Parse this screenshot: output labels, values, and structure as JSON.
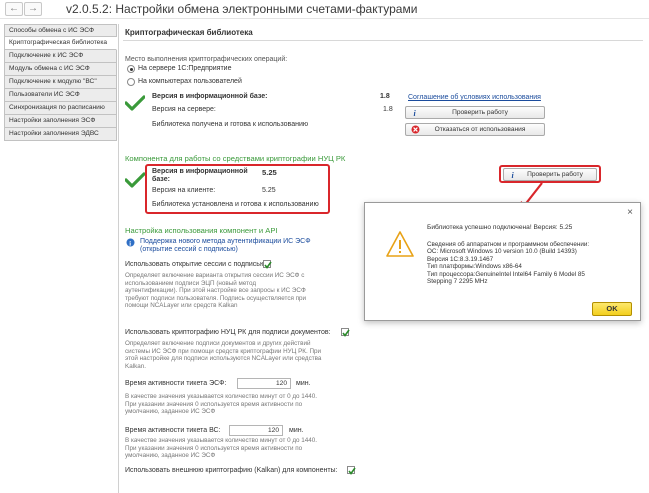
{
  "window": {
    "title": "v2.0.5.2: Настройки обмена электронными счетами-фактурами",
    "back_glyph": "←",
    "forward_glyph": "→"
  },
  "sidebar": {
    "items": [
      {
        "label": "Способы обмена с ИС ЭСФ"
      },
      {
        "label": "Криптографическая библиотека"
      },
      {
        "label": "Подключение к ИС ЭСФ"
      },
      {
        "label": "Модуль обмена с ИС ЭСФ"
      },
      {
        "label": "Подключение к модулю \"ВС\""
      },
      {
        "label": "Пользователи ИС ЭСФ"
      },
      {
        "label": "Синхронизация по расписанию"
      },
      {
        "label": "Настройки заполнения ЭСФ"
      },
      {
        "label": "Настройки заполнения ЭДВС"
      }
    ]
  },
  "crypto": {
    "title": "Криптографическая библиотека",
    "location_label": "Место выполнения криптографических операций:",
    "radio_server": "На сервере 1С:Предприятие",
    "radio_client": "На компьютерах пользователей",
    "version_db_label": "Версия в информационной базе:",
    "version_db": "1.8",
    "version_server_label": "Версия на сервере:",
    "version_server": "1.8",
    "status": "Библиотека получена и готова к использованию",
    "agreement_link": "Соглашение об условиях использования",
    "check_button": "Проверить работу",
    "refuse_button": "Отказаться от использования"
  },
  "ncu": {
    "title": "Компонента для работы со средствами криптографии НУЦ РК",
    "version_db_label_1": "Версия в информационной",
    "version_db_label_2": "базе:",
    "version_db": "5.25",
    "version_client_label": "Версия на клиенте:",
    "version_client": "5.25",
    "status": "Библиотека установлена и готова к использованию",
    "check_button": "Проверить работу"
  },
  "api": {
    "title": "Настройка использования компонент и API",
    "support_line1": "Поддержка нового метода аутентификации ИС ЭСФ",
    "support_line2": "(открытие сессий с подписью)",
    "open_session_label": "Использовать открытие сессии с подписью:",
    "open_session_desc": "Определяет включение варианта открытия сессии ИС ЭСФ с использованием подписи ЭЦП (новый метод аутентификации). При этой настройке все запросы к ИС ЭСФ требуют подписи пользователя. Подпись осуществляется при помощи NCALayer или средств Kalkan",
    "ncu_sign_label": "Использовать криптографию НУЦ РК для подписи документов:",
    "ncu_sign_desc": "Определяет включение подписи документов и других действий системы ИС ЭСФ при помощи средств криптографии НУЦ РК. При этой настройке для подписи используются NCALayer или средства Kalkan.",
    "esf_ticket_label": "Время активности тикета ЭСФ:",
    "esf_ticket_value": "120",
    "esf_ticket_unit": "мин.",
    "esf_ticket_desc": "В качестве значения указывается количество минут от 0 до 1440. При указании значения 0 используется время активности по умолчанию, заданное ИС ЭСФ",
    "vs_ticket_label": "Время активности тикета ВС:",
    "vs_ticket_value": "120",
    "vs_ticket_unit": "мин.",
    "vs_ticket_desc": "В качестве значения указывается количество минут от 0 до 1440. При указании значения 0 используется время активности по умолчанию, заданное ИС ЭСФ",
    "kalkan_label": "Использовать внешнюю криптографию (Kalkan) для компоненты:"
  },
  "dialog": {
    "close_glyph": "×",
    "message": "Библиотека успешно подключена! Версия: 5.25",
    "info": [
      "Сведения об аппаратном и программном обеспечении:",
      "ОС: Microsoft Windows 10 version 10.0  (Build 14393)",
      "Версия 1С:8.3.19.1467",
      "Тип платформы:Windows x86-64",
      "Тип процессора:GenuineIntel Intel64 Family 6 Model 85",
      "Stepping 7 2295 MHz"
    ],
    "ok_button": "OK"
  },
  "colors": {
    "accent_green": "#3a9a3a",
    "highlight_red": "#d9262b",
    "link_blue": "#1a4b9c",
    "ok_yellow": "#f3cf1e"
  }
}
